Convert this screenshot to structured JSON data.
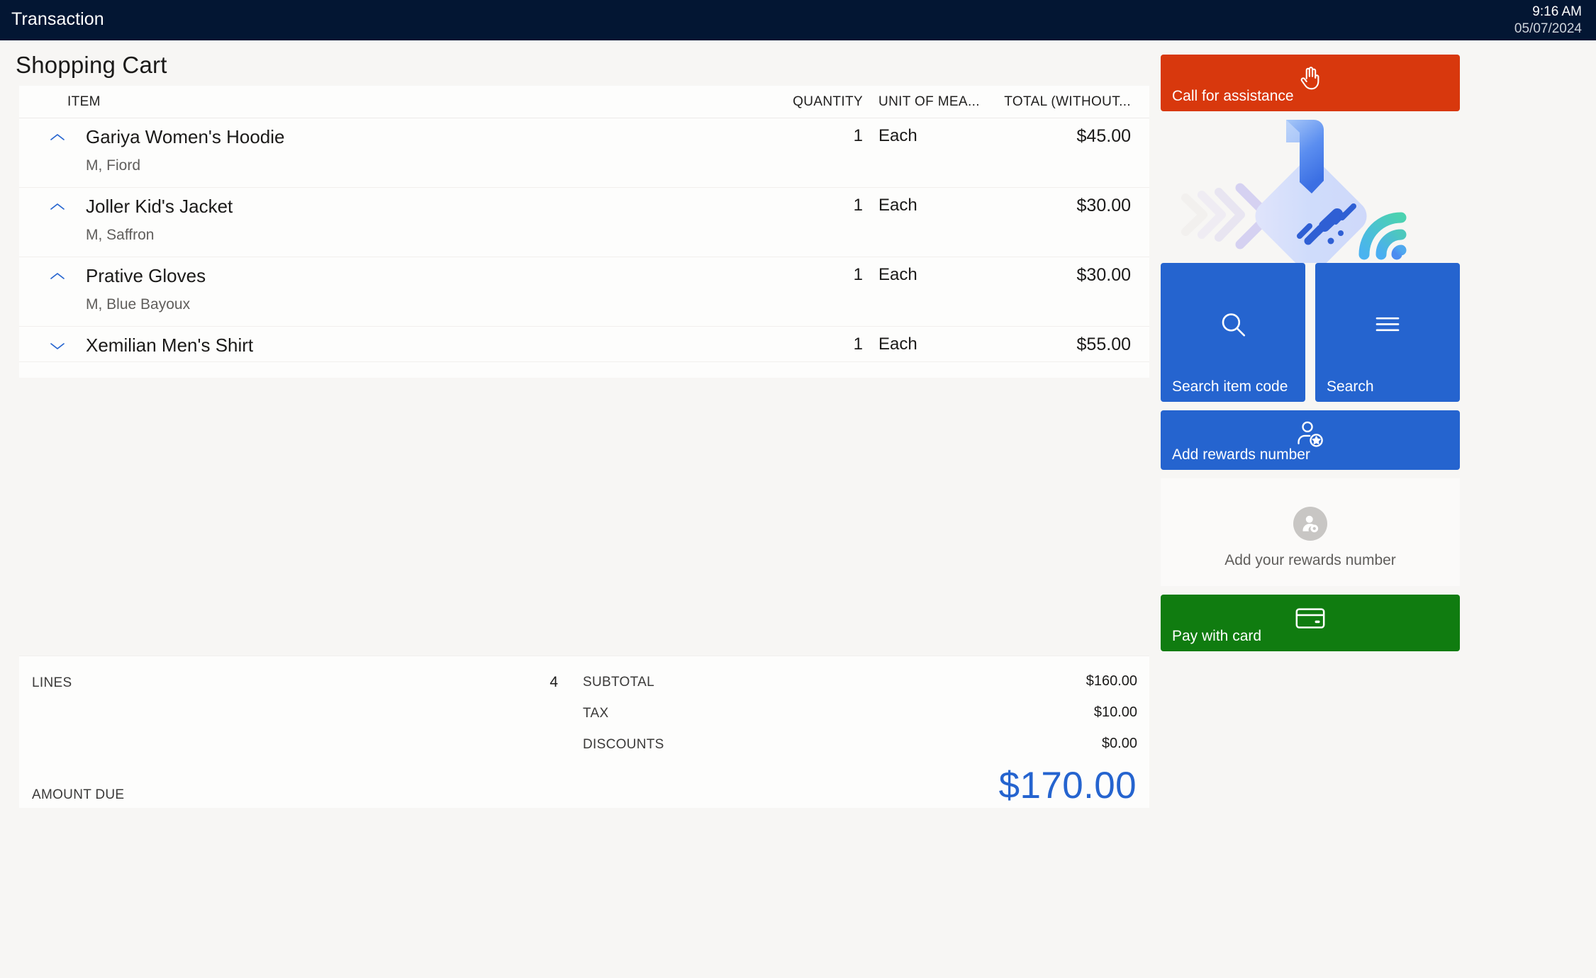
{
  "topbar": {
    "title": "Transaction",
    "time": "9:16 AM",
    "date": "05/07/2024"
  },
  "page": {
    "title": "Shopping Cart"
  },
  "cart": {
    "columns": {
      "item": "ITEM",
      "quantity": "QUANTITY",
      "unit_of_measure": "UNIT OF MEA...",
      "total": "TOTAL (WITHOUT..."
    },
    "rows": [
      {
        "name": "Gariya Women's Hoodie",
        "variant": "M, Fiord",
        "quantity": "1",
        "unit_of_measure": "Each",
        "total": "$45.00",
        "expanded": true,
        "chevron": "chevron-up-icon"
      },
      {
        "name": "Joller Kid's Jacket",
        "variant": "M, Saffron",
        "quantity": "1",
        "unit_of_measure": "Each",
        "total": "$30.00",
        "expanded": true,
        "chevron": "chevron-up-icon"
      },
      {
        "name": "Prative Gloves",
        "variant": "M, Blue Bayoux",
        "quantity": "1",
        "unit_of_measure": "Each",
        "total": "$30.00",
        "expanded": true,
        "chevron": "chevron-up-icon"
      },
      {
        "name": "Xemilian Men's Shirt",
        "variant": "",
        "quantity": "1",
        "unit_of_measure": "Each",
        "total": "$55.00",
        "expanded": false,
        "chevron": "chevron-down-icon"
      }
    ]
  },
  "totals": {
    "lines_label": "LINES",
    "lines_value": "4",
    "subtotal_label": "SUBTOTAL",
    "subtotal_value": "$160.00",
    "tax_label": "TAX",
    "tax_value": "$10.00",
    "discounts_label": "DISCOUNTS",
    "discounts_value": "$0.00",
    "amount_due_label": "AMOUNT DUE",
    "amount_due_value": "$170.00"
  },
  "rail": {
    "call_for_assistance": {
      "label": "Call for assistance",
      "icon": "raised-hand-icon",
      "color": "#d8380d"
    },
    "promo_illustration": {
      "icon": "contactless-tap-to-pay-illustration"
    },
    "search_item_code": {
      "label": "Search item code",
      "icon": "magnifier-icon",
      "color": "#2564cf"
    },
    "search": {
      "label": "Search",
      "icon": "hamburger-menu-icon",
      "color": "#2564cf"
    },
    "add_rewards_number": {
      "label": "Add rewards number",
      "icon": "person-star-icon",
      "color": "#2564cf"
    },
    "rewards_placeholder": {
      "hint": "Add your rewards number",
      "icon": "person-badge-icon"
    },
    "pay_with_card": {
      "label": "Pay with card",
      "icon": "credit-card-icon",
      "color": "#107c10"
    }
  }
}
